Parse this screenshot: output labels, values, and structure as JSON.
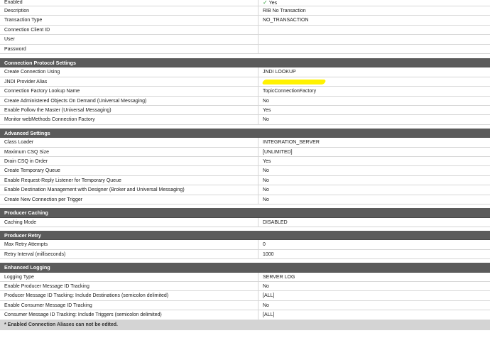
{
  "general": [
    {
      "label": "Enabled",
      "value": "Yes",
      "check": true
    },
    {
      "label": "Description",
      "value": "RIB No Transaction"
    },
    {
      "label": "Transaction Type",
      "value": "NO_TRANSACTION"
    },
    {
      "label": "Connection Client ID",
      "value": ""
    },
    {
      "label": "User",
      "value": ""
    },
    {
      "label": "Password",
      "value": ""
    }
  ],
  "sections": [
    {
      "title": "Connection Protocol Settings",
      "rows": [
        {
          "label": "Create Connection Using",
          "value": "JNDI LOOKUP"
        },
        {
          "label": "JNDI Provider Alias",
          "value": "",
          "redacted": true
        },
        {
          "label": "Connection Factory Lookup Name",
          "value": "TopicConnectionFactory"
        },
        {
          "label": "Create Administered Objects On Demand (Universal Messaging)",
          "value": "No"
        },
        {
          "label": "Enable Follow the Master (Universal Messaging)",
          "value": "Yes"
        },
        {
          "label": "Monitor webMethods Connection Factory",
          "value": "No"
        }
      ]
    },
    {
      "title": "Advanced Settings",
      "rows": [
        {
          "label": "Class Loader",
          "value": "INTEGRATION_SERVER"
        },
        {
          "label": "Maximum CSQ Size",
          "value": "[UNLIMITED]"
        },
        {
          "label": "Drain CSQ in Order",
          "value": "Yes"
        },
        {
          "label": "Create Temporary Queue",
          "value": "No"
        },
        {
          "label": "Enable Request-Reply Listener for Temporary Queue",
          "value": "No"
        },
        {
          "label": "Enable Destination Management with Designer (Broker and Universal Messaging)",
          "value": "No"
        },
        {
          "label": "Create New Connection per Trigger",
          "value": "No"
        }
      ]
    },
    {
      "title": "Producer Caching",
      "rows": [
        {
          "label": "Caching Mode",
          "value": "DISABLED"
        }
      ]
    },
    {
      "title": "Producer Retry",
      "rows": [
        {
          "label": "Max Retry Attempts",
          "value": "0"
        },
        {
          "label": "Retry Interval (milliseconds)",
          "value": "1000"
        }
      ]
    },
    {
      "title": "Enhanced Logging",
      "rows": [
        {
          "label": "Logging Type",
          "value": "SERVER LOG"
        },
        {
          "label": "Enable Producer Message ID Tracking",
          "value": "No"
        },
        {
          "label": "Producer Message ID Tracking: Include Destinations (semicolon delimited)",
          "value": "[ALL]"
        },
        {
          "label": "Enable Consumer Message ID Tracking",
          "value": "No"
        },
        {
          "label": "Consumer Message ID Tracking: Include Triggers (semicolon delimited)",
          "value": "[ALL]"
        }
      ]
    }
  ],
  "footer": "* Enabled Connection Aliases can not be edited.",
  "colors": {
    "section_header": "#5b5b5b",
    "check": "#2e9e3a",
    "redaction": "#fff200"
  },
  "icons": {
    "enabled": "check-icon"
  }
}
